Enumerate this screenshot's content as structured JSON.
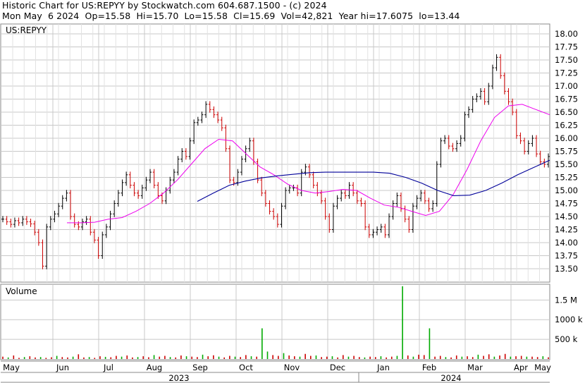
{
  "header": {
    "line1": "Historic Chart for US:REPYY by Stockwatch.com 604.687.1500 - (c) 2024",
    "line2": "Mon May  6 2024  Op=15.58  Hi=15.70  Lo=15.58  Cl=15.69  Vol=42,821  Year hi=17.6075  lo=13.44"
  },
  "price_panel_label": "US:REPYY",
  "volume_panel_label": "Volume",
  "colors": {
    "up_bar": "#000000",
    "down_bar": "#cc0000",
    "ma_short": "#ee00ee",
    "ma_long": "#000099",
    "vol_up": "#00aa00",
    "vol_down": "#cc0000",
    "grid": "#c8c8c8"
  },
  "chart_data": [
    {
      "type": "line",
      "panel": "price",
      "ylim": [
        13.25,
        18.15
      ],
      "yticks": [
        "18.00",
        "17.75",
        "17.50",
        "17.25",
        "17.00",
        "16.75",
        "16.50",
        "16.25",
        "16.00",
        "15.75",
        "15.50",
        "15.25",
        "15.00",
        "14.75",
        "14.50",
        "14.25",
        "14.00",
        "13.75",
        "13.50"
      ],
      "x_months": [
        "May",
        "Jun",
        "Jul",
        "Aug",
        "Sep",
        "Oct",
        "Nov",
        "Dec",
        "Jan",
        "Feb",
        "Mar",
        "Apr",
        "May"
      ],
      "x_years": [
        "2023",
        "2024"
      ],
      "series": [
        {
          "name": "price_close",
          "values": [
            14.45,
            14.4,
            14.35,
            14.42,
            14.38,
            14.45,
            14.4,
            14.36,
            14.2,
            14.0,
            13.55,
            14.3,
            14.45,
            14.55,
            14.7,
            14.85,
            14.95,
            14.5,
            14.35,
            14.3,
            14.4,
            14.45,
            14.2,
            14.05,
            13.75,
            14.15,
            14.3,
            14.55,
            14.75,
            14.95,
            15.15,
            15.3,
            15.1,
            14.95,
            14.9,
            15.05,
            15.2,
            15.35,
            15.1,
            14.9,
            14.8,
            15.0,
            15.2,
            15.35,
            15.6,
            15.75,
            15.65,
            15.95,
            16.3,
            16.35,
            16.45,
            16.65,
            16.55,
            16.45,
            16.35,
            16.2,
            15.8,
            15.2,
            15.15,
            15.35,
            15.6,
            15.8,
            15.95,
            15.55,
            15.2,
            14.95,
            14.75,
            14.6,
            14.5,
            14.35,
            14.7,
            15.0,
            15.05,
            15.05,
            14.95,
            15.35,
            15.45,
            15.3,
            15.1,
            14.95,
            14.8,
            14.5,
            14.25,
            14.7,
            14.85,
            14.95,
            14.9,
            15.1,
            14.95,
            14.8,
            14.75,
            14.3,
            14.15,
            14.2,
            14.25,
            14.3,
            14.15,
            14.5,
            14.75,
            14.9,
            14.65,
            14.45,
            14.25,
            14.7,
            14.85,
            14.95,
            14.8,
            14.65,
            14.75,
            15.5,
            15.95,
            16.0,
            15.85,
            15.8,
            15.9,
            16.0,
            16.45,
            16.55,
            16.75,
            16.8,
            16.9,
            16.7,
            17.0,
            17.35,
            17.55,
            17.2,
            16.9,
            16.7,
            16.5,
            16.05,
            15.95,
            15.75,
            15.9,
            16.0,
            15.7,
            15.55,
            15.5,
            15.65
          ]
        },
        {
          "name": "ma_short",
          "values": [
            14.38,
            14.38,
            14.39,
            14.45,
            14.48,
            14.6,
            14.75,
            14.95,
            15.2,
            15.5,
            15.8,
            15.98,
            15.95,
            15.7,
            15.45,
            15.3,
            15.12,
            15.0,
            14.95,
            14.98,
            15.02,
            15.0,
            14.85,
            14.72,
            14.68,
            14.6,
            14.52,
            14.6,
            14.92,
            15.4,
            15.95,
            16.4,
            16.62,
            16.65,
            16.55,
            16.45
          ]
        },
        {
          "name": "ma_long",
          "values": [
            14.79,
            14.95,
            15.1,
            15.18,
            15.24,
            15.28,
            15.31,
            15.34,
            15.35,
            15.35,
            15.35,
            15.35,
            15.33,
            15.25,
            15.14,
            15.0,
            14.9,
            14.91,
            15.0,
            15.14,
            15.3,
            15.44,
            15.58
          ]
        }
      ]
    },
    {
      "type": "bar",
      "panel": "volume",
      "yticks": [
        "1.5 M",
        "1000 k",
        "500 k"
      ],
      "ylim": [
        0,
        1900000
      ],
      "notes": "daily volume bars, peaks near Oct 2023 and late Jan 2024",
      "series": [
        {
          "name": "volume",
          "values": [
            60000,
            40000,
            90000,
            30000,
            50000,
            70000,
            40000,
            50000,
            30000,
            45000,
            80000,
            50000,
            40000,
            60000,
            120000,
            40000,
            50000,
            30000,
            70000,
            55000,
            45000,
            80000,
            60000,
            90000,
            40000,
            50000,
            70000,
            45000,
            100000,
            60000,
            80000,
            50000,
            40000,
            90000,
            70000,
            60000,
            50000,
            110000,
            70000,
            95000,
            60000,
            40000,
            80000,
            60000,
            50000,
            100000,
            70000,
            60000,
            780000,
            190000,
            100000,
            80000,
            150000,
            90000,
            70000,
            60000,
            130000,
            80000,
            90000,
            50000,
            60000,
            70000,
            40000,
            100000,
            60000,
            80000,
            50000,
            40000,
            60000,
            50000,
            70000,
            40000,
            60000,
            80000,
            1850000,
            90000,
            60000,
            110000,
            100000,
            780000,
            60000,
            80000,
            50000,
            40000,
            90000,
            60000,
            70000,
            50000,
            110000,
            80000,
            120000,
            60000,
            90000,
            130000,
            60000,
            70000,
            80000,
            60000,
            60000,
            50000,
            70000,
            42821
          ]
        }
      ]
    }
  ]
}
